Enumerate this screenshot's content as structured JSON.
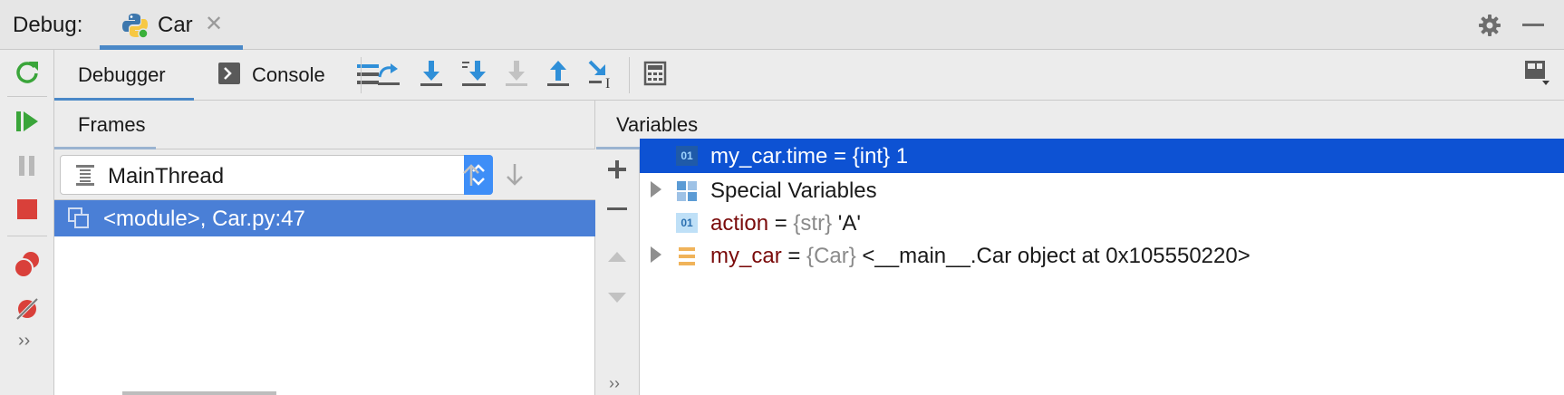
{
  "titlebar": {
    "debug_label": "Debug:",
    "run_tab_label": "Car",
    "close_glyph": "✕",
    "minimize_glyph": "—"
  },
  "subtoolbar": {
    "tabs": [
      {
        "label": "Debugger"
      },
      {
        "label": "Console"
      }
    ]
  },
  "frames": {
    "tab_label": "Frames",
    "thread": "MainThread",
    "items": [
      {
        "label": "<module>, Car.py:47"
      }
    ]
  },
  "variables": {
    "tab_label": "Variables",
    "items": [
      {
        "full": "my_car.time = {int} 1",
        "type_icon": "01"
      },
      {
        "label": "Special Variables"
      },
      {
        "name": "action",
        "eq": " = ",
        "type": "{str}",
        "value": " 'A'",
        "type_icon": "01"
      },
      {
        "name": "my_car",
        "eq": " = ",
        "type": "{Car}",
        "value": " <__main__.Car object at 0x105550220>"
      }
    ]
  },
  "colors": {
    "accent": "#4a88c7",
    "selection": "#0d52d3",
    "frame_selection": "#4a7fd6",
    "var_name": "#7a0a0a",
    "type_gray": "#8a8a8a",
    "icon_blue": "#2f8fd8",
    "icon_green": "#3aa53a",
    "icon_red": "#d9403a"
  },
  "icons": {
    "left_bar": [
      "rerun-icon",
      "resume-icon",
      "pause-icon",
      "stop-icon",
      "view-breakpoints-icon",
      "mute-breakpoints-icon",
      "more-icon"
    ],
    "toolbar": [
      "show-execution-point-icon",
      "step-over-icon",
      "step-into-icon",
      "step-into-my-code-icon",
      "force-step-into-icon",
      "step-out-icon",
      "run-to-cursor-icon",
      "evaluate-expression-icon",
      "restore-layout-icon"
    ],
    "header": [
      "settings-gear-icon",
      "minimize-icon"
    ]
  }
}
